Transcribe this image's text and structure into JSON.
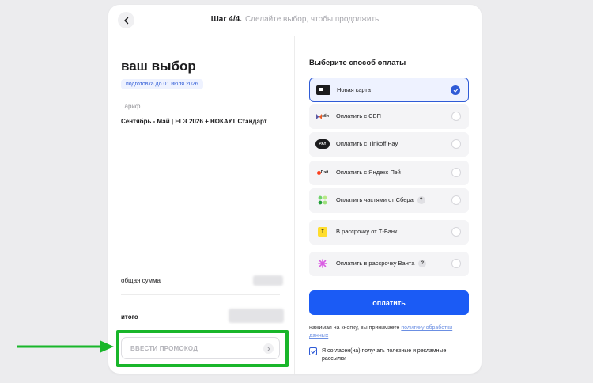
{
  "header": {
    "step": "Шаг 4/4.",
    "hint": "Сделайте выбор, чтобы продолжить"
  },
  "summary": {
    "title": "ваш выбор",
    "deadline": "подготовка до 01 июля 2026",
    "tariff_caption": "Тариф",
    "tariff_name": "Сентябрь - Май  | ЕГЭ 2026 + НОКАУТ Стандарт",
    "total_label": "общая сумма",
    "itogo_label": "итого",
    "promo_placeholder": "ВВЕСТИ ПРОМОКОД"
  },
  "payment": {
    "title": "Выберите способ оплаты",
    "methods": [
      {
        "label": "Новая карта",
        "icon": "card-icon",
        "selected": true
      },
      {
        "label": "Оплатить с СБП",
        "icon": "sbp-icon",
        "icon_text": "сбп",
        "selected": false
      },
      {
        "label": "Оплатить с Tinkoff Pay",
        "icon": "tinkoff-pay-icon",
        "icon_text": "PAY",
        "selected": false
      },
      {
        "label": "Оплатить с Яндекс Пэй",
        "icon": "yandex-pay-icon",
        "icon_text": "Пэй",
        "selected": false
      },
      {
        "label": "Оплатить частями от Сбера",
        "icon": "sber-icon",
        "selected": false,
        "has_help": true
      },
      {
        "label": "В рассрочку от Т-Банк",
        "icon": "tbank-icon",
        "icon_text": "T",
        "selected": false
      },
      {
        "label": "Оплатить в рассрочку Ванта",
        "icon": "vanta-icon",
        "selected": false,
        "has_help": true
      }
    ],
    "help_mark": "?",
    "pay_button": "оплатить",
    "consent_prefix": "нажимая на кнопку, вы принимаете ",
    "consent_link": "политику обработки данных",
    "agree_text": "Я согласен(на) получать полезные и рекламные рассылки",
    "agree_checked": true
  },
  "colors": {
    "accent": "#1b5bf5",
    "highlight": "#19b62a"
  }
}
